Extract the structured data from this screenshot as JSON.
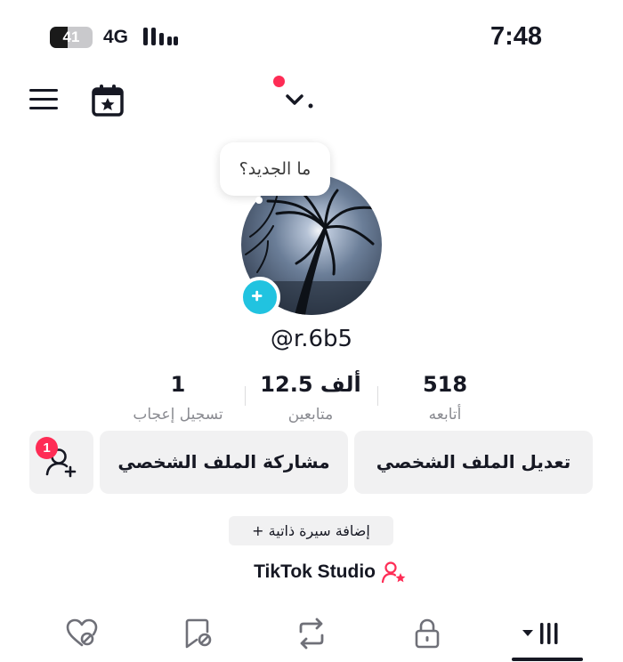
{
  "status_bar": {
    "battery": "41",
    "battery_level": 0.41,
    "network": "4G",
    "time": "7:48"
  },
  "header": {
    "menu_icon": "hamburger-menu-icon",
    "calendar_icon": "calendar-star-icon",
    "account_switch_icon": "chevron-down-icon",
    "notification_dot_color": "#fe2c55"
  },
  "profile": {
    "whats_new": "ما الجديد؟",
    "username": "@r.6b5",
    "add_badge_color": "#21c3e0"
  },
  "stats": [
    {
      "value": "1",
      "label": "تسجيل إعجاب"
    },
    {
      "value": "12.5 ألف",
      "label": "متابعين"
    },
    {
      "value": "518",
      "label": "أتابعه"
    }
  ],
  "actions": {
    "edit_profile": "تعديل الملف الشخصي",
    "share_profile": "مشاركة الملف الشخصي",
    "add_friends_badge": "1",
    "add_bio": "+ إضافة سيرة ذاتية",
    "studio": "TikTok Studio"
  },
  "tabs": [
    {
      "icon": "liked-heart-icon"
    },
    {
      "icon": "favorites-bookmark-icon"
    },
    {
      "icon": "reposts-icon"
    },
    {
      "icon": "private-lock-icon"
    },
    {
      "icon": "videos-grid-icon",
      "active": true
    }
  ],
  "colors": {
    "accent": "#fe2c55",
    "button_bg": "#f1f1f2",
    "text": "#161823"
  }
}
